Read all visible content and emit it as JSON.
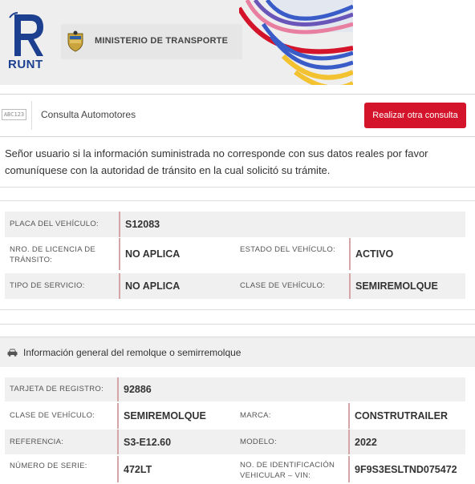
{
  "header": {
    "logo_text": "RUNT",
    "ministry": "MINISTERIO DE TRANSPORTE",
    "colors": {
      "runt_blue": "#1d3f8f",
      "accent_red": "#d3142a"
    }
  },
  "titlebar": {
    "icon_text": "ABC123",
    "title": "Consulta Automotores",
    "button": "Realizar otra consulta"
  },
  "notice": "Señor usuario si la información suministrada no corresponde con sus datos reales por favor comuníquese con la autoridad de tránsito en la cual solicitó su trámite.",
  "vehicle": {
    "placa_label": "PLACA DEL VEHÍCULO:",
    "placa_value": "S12083",
    "licencia_label": "NRO. DE LICENCIA DE TRÁNSITO:",
    "licencia_value": "NO APLICA",
    "estado_label": "ESTADO DEL VEHÍCULO:",
    "estado_value": "ACTIVO",
    "servicio_label": "TIPO DE SERVICIO:",
    "servicio_value": "NO APLICA",
    "clase_label": "CLASE DE VEHÍCULO:",
    "clase_value": "SEMIREMOLQUE"
  },
  "remolque": {
    "section_title": "Información general del remolque o semirremolque",
    "tarjeta_label": "TARJETA DE REGISTRO:",
    "tarjeta_value": "92886",
    "clase_label": "CLASE DE VEHÍCULO:",
    "clase_value": "SEMIREMOLQUE",
    "marca_label": "MARCA:",
    "marca_value": "CONSTRUTRAILER",
    "referencia_label": "REFERENCIA:",
    "referencia_value": "S3-E12.60",
    "modelo_label": "MODELO:",
    "modelo_value": "2022",
    "serie_label": "NÚMERO DE SERIE:",
    "serie_value": "472LT",
    "vin_label": "NO. DE IDENTIFICACIÓN VEHICULAR – VIN:",
    "vin_value": "9F9S3ESLTND075472"
  }
}
